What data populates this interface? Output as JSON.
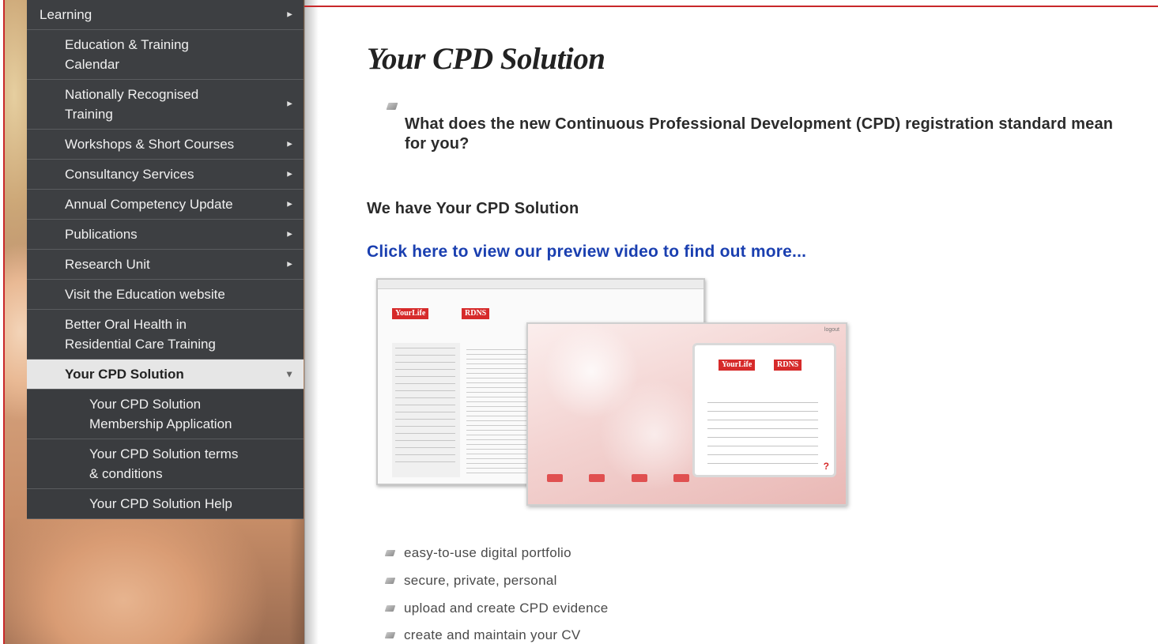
{
  "nav": {
    "items": [
      {
        "label": "Learning",
        "level": "top",
        "arrow": "►",
        "height": 38
      },
      {
        "label": "Education & Training\nCalendar",
        "level": "child",
        "arrow": "",
        "height": 63
      },
      {
        "label": "Nationally Recognised\nTraining",
        "level": "child",
        "arrow": "►",
        "height": 63
      },
      {
        "label": "Workshops & Short Courses",
        "level": "child",
        "arrow": "►",
        "height": 38
      },
      {
        "label": "Consultancy Services",
        "level": "child",
        "arrow": "►",
        "height": 38
      },
      {
        "label": "Annual Competency Update",
        "level": "child",
        "arrow": "►",
        "height": 38
      },
      {
        "label": "Publications",
        "level": "child",
        "arrow": "►",
        "height": 38
      },
      {
        "label": "Research Unit",
        "level": "child",
        "arrow": "►",
        "height": 38
      },
      {
        "label": "Visit the Education website",
        "level": "child",
        "arrow": "",
        "height": 38
      },
      {
        "label": "Better Oral Health in\nResidential Care Training",
        "level": "child",
        "arrow": "",
        "height": 63
      },
      {
        "label": "Your CPD Solution",
        "level": "active",
        "arrow": "▼",
        "height": 38
      },
      {
        "label": "Your CPD Solution\nMembership Application",
        "level": "sub",
        "arrow": "",
        "height": 63
      },
      {
        "label": "Your CPD Solution terms\n& conditions",
        "level": "sub",
        "arrow": "",
        "height": 63
      },
      {
        "label": "Your CPD Solution Help",
        "level": "sub",
        "arrow": "",
        "height": 38
      }
    ]
  },
  "main": {
    "title": "Your CPD Solution",
    "question": "What does the new Continuous Professional Development (CPD) registration standard mean for you?",
    "subhead": "We have Your CPD Solution",
    "video_link": "Click here to view our preview video to find out more...",
    "preview": {
      "logo_yourlife": "YourLife",
      "logo_rdns": "RDNS",
      "help_glyph": "?",
      "login_text": "logout"
    },
    "features": [
      "easy-to-use digital portfolio",
      "secure, private, personal",
      "upload and create CPD evidence",
      "create and maintain your CV"
    ]
  },
  "colors": {
    "nav_bg": "#3d3f42",
    "nav_active_bg": "#e6e6e6",
    "link": "#1a3fb0",
    "frame": "#c8282a"
  }
}
